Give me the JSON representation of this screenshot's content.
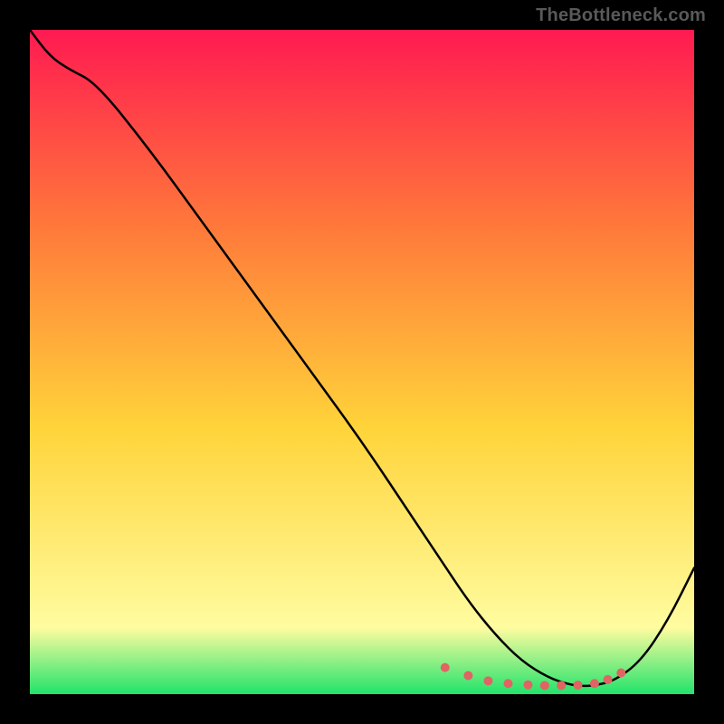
{
  "watermark": "TheBottleneck.com",
  "colors": {
    "gradient_top": "#ff1a51",
    "gradient_mid1": "#ff7a3a",
    "gradient_mid2": "#ffd43a",
    "gradient_mid3": "#fffca0",
    "gradient_bottom": "#21e36b",
    "curve": "#000000",
    "dots": "#e06464",
    "frame": "#000000"
  },
  "chart_data": {
    "type": "line",
    "title": "",
    "xlabel": "",
    "ylabel": "",
    "xlim": [
      0,
      100
    ],
    "ylim": [
      0,
      100
    ],
    "curve": {
      "x": [
        0,
        3,
        6,
        10,
        18,
        26,
        34,
        42,
        50,
        58,
        62,
        66,
        70,
        74,
        78,
        81,
        83,
        85,
        88,
        92,
        96,
        100
      ],
      "y": [
        100,
        96,
        94,
        92,
        82,
        71,
        60,
        49,
        38,
        26,
        20,
        14,
        9,
        5,
        2.5,
        1.5,
        1.2,
        1.3,
        2,
        5,
        11,
        19
      ]
    },
    "dots": {
      "x": [
        62.5,
        66,
        69,
        72,
        75,
        77.5,
        80,
        82.5,
        85,
        87,
        89
      ],
      "y": [
        4.0,
        2.8,
        2.0,
        1.6,
        1.4,
        1.3,
        1.3,
        1.35,
        1.6,
        2.2,
        3.2
      ]
    }
  }
}
